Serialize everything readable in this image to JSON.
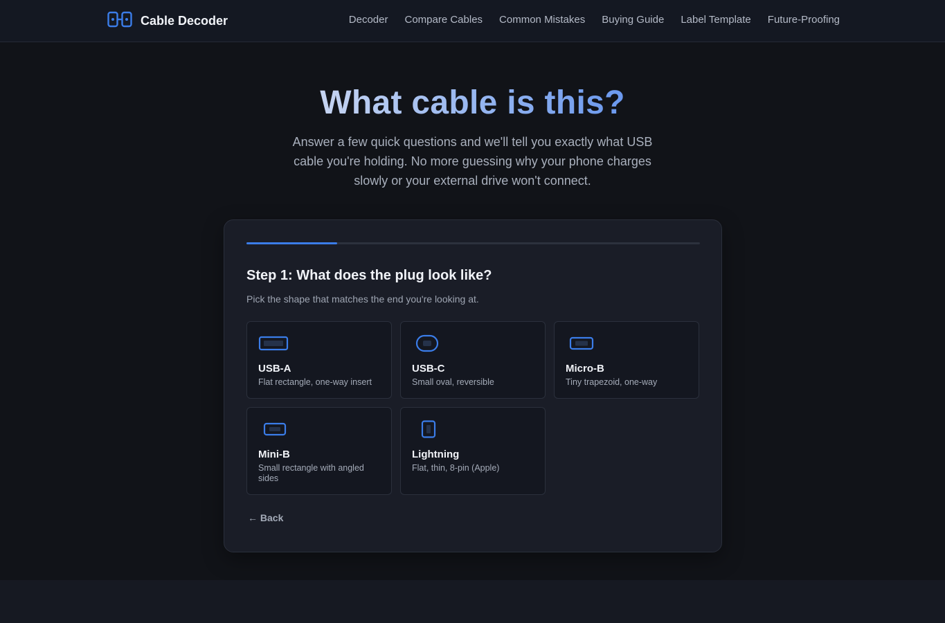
{
  "brand": {
    "name": "Cable Decoder",
    "logo_icon": "cable-connector-icon",
    "accent": "#3b7de9"
  },
  "nav": {
    "items": [
      {
        "label": "Decoder"
      },
      {
        "label": "Compare Cables"
      },
      {
        "label": "Common Mistakes"
      },
      {
        "label": "Buying Guide"
      },
      {
        "label": "Label Template"
      },
      {
        "label": "Future-Proofing"
      }
    ]
  },
  "hero": {
    "title": "What cable is this?",
    "subtitle": "Answer a few quick questions and we'll tell you exactly what USB cable you're holding. No more guessing why your phone charges slowly or your external drive won't connect."
  },
  "wizard": {
    "progress": 0.2,
    "step_title": "Step 1: What does the plug look like?",
    "step_subtitle": "Pick the shape that matches the end you're looking at.",
    "options": [
      {
        "title": "USB-A",
        "description": "Flat rectangle, one-way insert",
        "icon": "usb-a-plug-icon"
      },
      {
        "title": "USB-C",
        "description": "Small oval, reversible",
        "icon": "usb-c-plug-icon"
      },
      {
        "title": "Micro-B",
        "description": "Tiny trapezoid, one-way",
        "icon": "micro-b-plug-icon"
      },
      {
        "title": "Mini-B",
        "description": "Small rectangle with angled sides",
        "icon": "mini-b-plug-icon"
      },
      {
        "title": "Lightning",
        "description": "Flat, thin, 8-pin (Apple)",
        "icon": "lightning-plug-icon"
      }
    ],
    "back_label": "← Back"
  }
}
